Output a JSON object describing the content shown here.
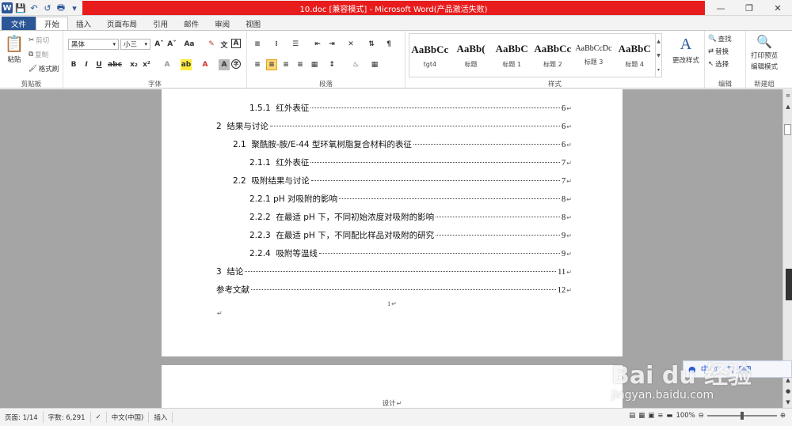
{
  "window": {
    "title": "10.doc [兼容模式] - Microsoft Word(产品激活失败)",
    "title_bar_color": "#e81c1c",
    "app_icon": "word-icon",
    "minimize_icon": "minimize-icon",
    "maximize_icon": "maximize-icon",
    "close_icon": "close-icon"
  },
  "tabs": [
    "文件",
    "开始",
    "插入",
    "页面布局",
    "引用",
    "邮件",
    "审阅",
    "视图"
  ],
  "ribbon": {
    "clipboard": {
      "paste": "粘贴",
      "cut": "剪切",
      "copy": "复制",
      "format_painter": "格式刷",
      "label": "剪贴板"
    },
    "font": {
      "font_name": "黑体",
      "font_size": "小三",
      "label": "字体"
    },
    "paragraph": {
      "label": "段落"
    },
    "styles": {
      "label": "样式",
      "items": [
        {
          "sample": "AaBbCc",
          "name": "tgt4"
        },
        {
          "sample": "AaBb(",
          "name": "标题"
        },
        {
          "sample": "AaBbC",
          "name": "标题 1"
        },
        {
          "sample": "AaBbCc",
          "name": "标题 2"
        },
        {
          "sample": "AaBbCcDc",
          "name": "标题 3"
        },
        {
          "sample": "AaBbC",
          "name": "标题 4"
        }
      ],
      "change_styles": "更改样式"
    },
    "editing": {
      "find": "查找",
      "replace": "替换",
      "select": "选择",
      "label": "编辑"
    },
    "new_group": {
      "print_preview": "打印预览",
      "edit_mode": "编辑模式",
      "label": "新建组"
    }
  },
  "document": {
    "toc": [
      {
        "num": "1.5.1",
        "text": "红外表征",
        "page": "6",
        "level": 3
      },
      {
        "num": "2",
        "text": "结果与讨论",
        "page": "6",
        "level": 1
      },
      {
        "num": "2.1",
        "text": "聚酰胺-胺/E-44 型环氧树脂复合材料的表征",
        "page": "6",
        "level": 2
      },
      {
        "num": "2.1.1",
        "text": "红外表征",
        "page": "7",
        "level": 3
      },
      {
        "num": "2.2",
        "text": "吸附结果与讨论",
        "page": "7",
        "level": 2
      },
      {
        "num": "2.2.1",
        "text": "pH 对吸附的影响",
        "page": "8",
        "level": 3
      },
      {
        "num": "2.2.2",
        "text": "在最适 pH 下，不同初始浓度对吸附的影响",
        "page": "8",
        "level": 3
      },
      {
        "num": "2.2.3",
        "text": "在最适 pH 下，不同配比样品对吸附的研究",
        "page": "9",
        "level": 3
      },
      {
        "num": "2.2.4",
        "text": "吸附等温线",
        "page": "9",
        "level": 3
      },
      {
        "num": "3",
        "text": "结论",
        "page": "11",
        "level": 1
      },
      {
        "num": "",
        "text": "参考文献",
        "page": "12",
        "level": 1
      }
    ],
    "page_number": "1",
    "next_page_header": "设计"
  },
  "watermark": {
    "logo": "Bai du 经验",
    "url": "jingyan.baidu.com"
  },
  "statusbar": {
    "page": "页面: 1/14",
    "words": "字数: 6,291",
    "language": "中文(中国)",
    "mode": "插入",
    "zoom": "100%"
  }
}
